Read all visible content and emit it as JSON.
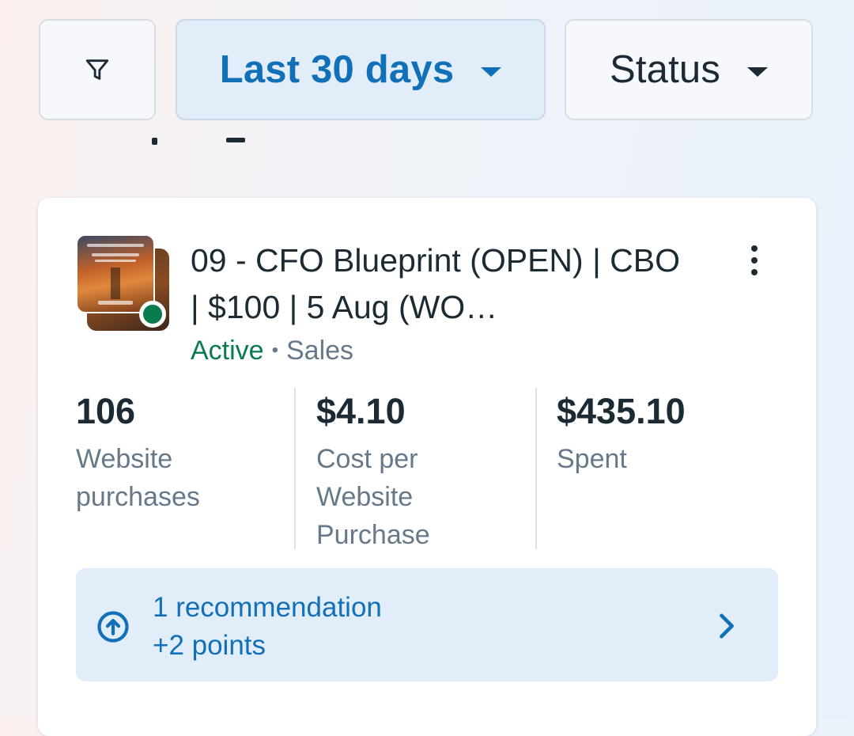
{
  "filters": {
    "filter_icon": "filter-funnel-icon",
    "date_range": {
      "label": "Last 30 days",
      "icon": "caret-down-icon"
    },
    "status": {
      "label": "Status",
      "icon": "caret-down-icon"
    }
  },
  "campaign": {
    "name": "09 - CFO Blueprint (OPEN) | CBO | $100 | 5 Aug (WO…",
    "status": "Active",
    "separator": "•",
    "objective": "Sales",
    "more_icon": "more-vertical-icon",
    "thumbnail_icon": "ad-creative-thumbnail",
    "status_color": "#0a7b4e",
    "metrics": [
      {
        "value": "106",
        "label": "Website purchases"
      },
      {
        "value": "$4.10",
        "label": "Cost per Website Purchase"
      },
      {
        "value": "$435.10",
        "label": "Spent"
      }
    ],
    "recommendation": {
      "title": "1 recommendation",
      "subtitle": "+2 points",
      "icon": "arrow-up-circle-icon",
      "chevron": "chevron-right-icon"
    }
  },
  "colors": {
    "accent": "#1170b8",
    "accent_bg": "#e1edf8",
    "text_primary": "#1c2b33",
    "text_secondary": "#67788a",
    "active_green": "#0a7b4e"
  }
}
